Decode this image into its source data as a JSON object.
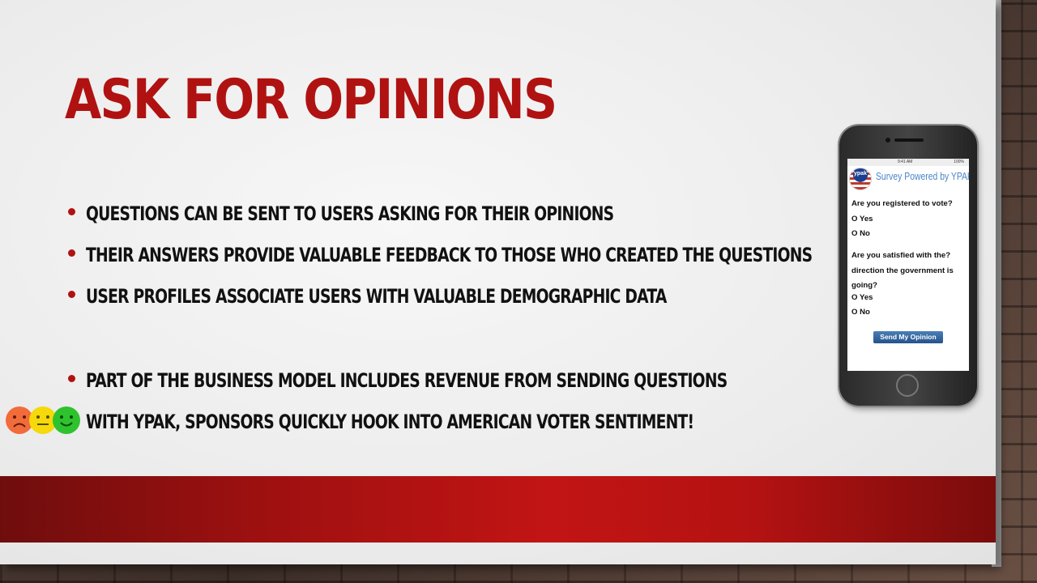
{
  "slide": {
    "title": "Ask for Opinions",
    "bullets": [
      "Questions can be sent to users asking for their opinions",
      "Their answers provide valuable feedback to those who created the questions",
      "User profiles associate users with valuable demographic data",
      "Part of the business model includes revenue from sending questions",
      "With YPAK, sponsors quickly hook into American voter sentiment!"
    ],
    "colors": {
      "accent": "#b01212",
      "text": "#111111",
      "band": "#b51212"
    }
  },
  "icons": [
    "sad-face-icon",
    "neutral-face-icon",
    "happy-face-icon"
  ],
  "phone": {
    "status_time": "9:41 AM",
    "status_battery": "100%",
    "logo_text": "ypak",
    "survey_title": "Survey Powered by YPAK",
    "question1": "Are you registered to vote?",
    "q1_option_yes": "O  Yes",
    "q1_option_no": "O  No",
    "question2_line1": "Are you satisfied with the?",
    "question2_line2": "direction the government is",
    "question2_line3": "going?",
    "q2_option_yes": "O  Yes",
    "q2_option_no": "O  No",
    "send_button": "Send My Opinion"
  }
}
